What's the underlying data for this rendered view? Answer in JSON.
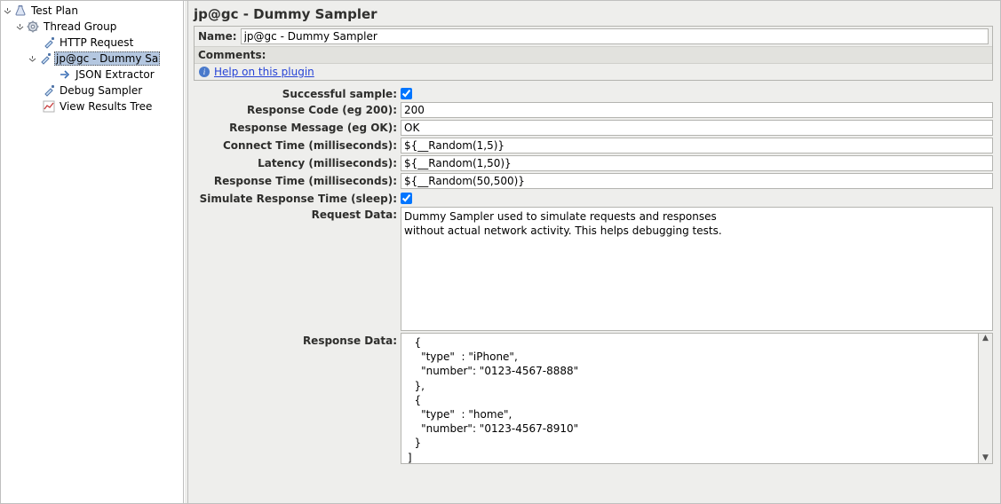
{
  "tree": {
    "root": "Test Plan",
    "thread_group": "Thread Group",
    "http_request": "HTTP Request",
    "dummy_sampler": "jp@gc - Dummy Sa",
    "json_extractor": "JSON Extractor",
    "debug_sampler": "Debug Sampler",
    "view_results": "View Results Tree"
  },
  "panel": {
    "title": "jp@gc - Dummy Sampler",
    "name_label": "Name:",
    "name_value": "jp@gc - Dummy Sampler",
    "comments_label": "Comments:",
    "help_link": "Help on this plugin"
  },
  "form": {
    "successful_label": "Successful sample:",
    "successful_checked": true,
    "response_code_label": "Response Code (eg 200):",
    "response_code_value": "200",
    "response_message_label": "Response Message (eg OK):",
    "response_message_value": "OK",
    "connect_time_label": "Connect Time (milliseconds):",
    "connect_time_value": "${__Random(1,5)}",
    "latency_label": "Latency (milliseconds):",
    "latency_value": "${__Random(1,50)}",
    "response_time_label": "Response Time (milliseconds):",
    "response_time_value": "${__Random(50,500)}",
    "simulate_label": "Simulate Response Time (sleep):",
    "simulate_checked": true,
    "request_data_label": "Request Data:",
    "request_data_value": "Dummy Sampler used to simulate requests and responses\nwithout actual network activity. This helps debugging tests.",
    "response_data_label": "Response Data:",
    "response_data_value": "   {\n     \"type\"  : \"iPhone\",\n     \"number\": \"0123-4567-8888\"\n   },\n   {\n     \"type\"  : \"home\",\n     \"number\": \"0123-4567-8910\"\n   }\n ]\n}"
  }
}
